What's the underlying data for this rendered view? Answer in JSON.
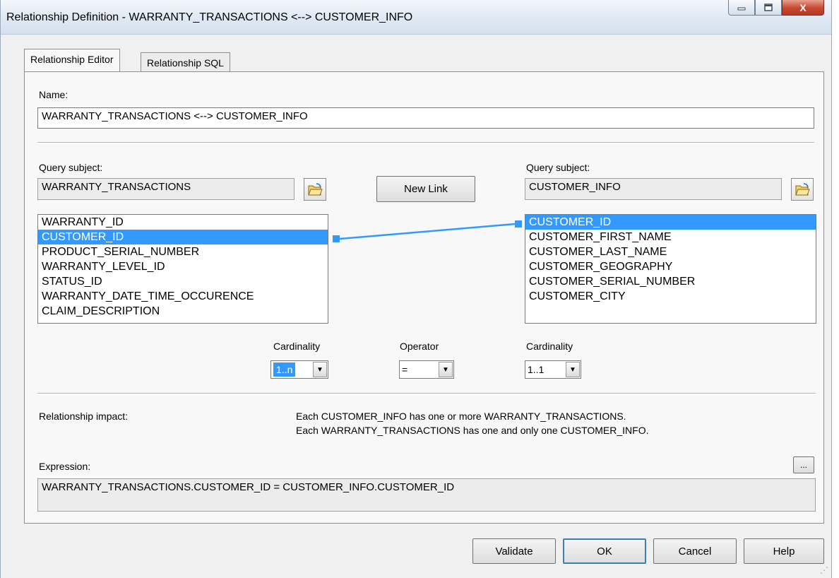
{
  "window": {
    "title": "Relationship Definition - WARRANTY_TRANSACTIONS <--> CUSTOMER_INFO",
    "minimize_icon": "minimize-icon",
    "maximize_icon": "maximize-icon",
    "close_label": "X"
  },
  "tabs": [
    {
      "label": "Relationship Editor",
      "active": true
    },
    {
      "label": "Relationship SQL",
      "active": false
    }
  ],
  "name_section": {
    "label": "Name:",
    "value": "WARRANTY_TRANSACTIONS <--> CUSTOMER_INFO"
  },
  "left": {
    "query_subject_label": "Query subject:",
    "query_subject_value": "WARRANTY_TRANSACTIONS",
    "items": [
      "WARRANTY_ID",
      "CUSTOMER_ID",
      "PRODUCT_SERIAL_NUMBER",
      "WARRANTY_LEVEL_ID",
      "STATUS_ID",
      "WARRANTY_DATE_TIME_OCCURENCE",
      "CLAIM_DESCRIPTION"
    ],
    "selected": "CUSTOMER_ID"
  },
  "right": {
    "query_subject_label": "Query subject:",
    "query_subject_value": "CUSTOMER_INFO",
    "items": [
      "CUSTOMER_ID",
      "CUSTOMER_FIRST_NAME",
      "CUSTOMER_LAST_NAME",
      "CUSTOMER_GEOGRAPHY",
      "CUSTOMER_SERIAL_NUMBER",
      "CUSTOMER_CITY"
    ],
    "selected": "CUSTOMER_ID"
  },
  "new_link_label": "New Link",
  "cardinality_left": {
    "label": "Cardinality",
    "value": "1..n"
  },
  "operator": {
    "label": "Operator",
    "value": "="
  },
  "cardinality_right": {
    "label": "Cardinality",
    "value": "1..1"
  },
  "impact": {
    "label": "Relationship impact:",
    "line1": "Each CUSTOMER_INFO has one or more WARRANTY_TRANSACTIONS.",
    "line2": "Each WARRANTY_TRANSACTIONS has one and only one CUSTOMER_INFO."
  },
  "expression": {
    "label": "Expression:",
    "button_label": "...",
    "value": "WARRANTY_TRANSACTIONS.CUSTOMER_ID = CUSTOMER_INFO.CUSTOMER_ID"
  },
  "buttons": {
    "validate": "Validate",
    "ok": "OK",
    "cancel": "Cancel",
    "help": "Help"
  },
  "colors": {
    "selection": "#3399ff",
    "link_line": "#3399ff",
    "close_button": "#c7462f"
  }
}
